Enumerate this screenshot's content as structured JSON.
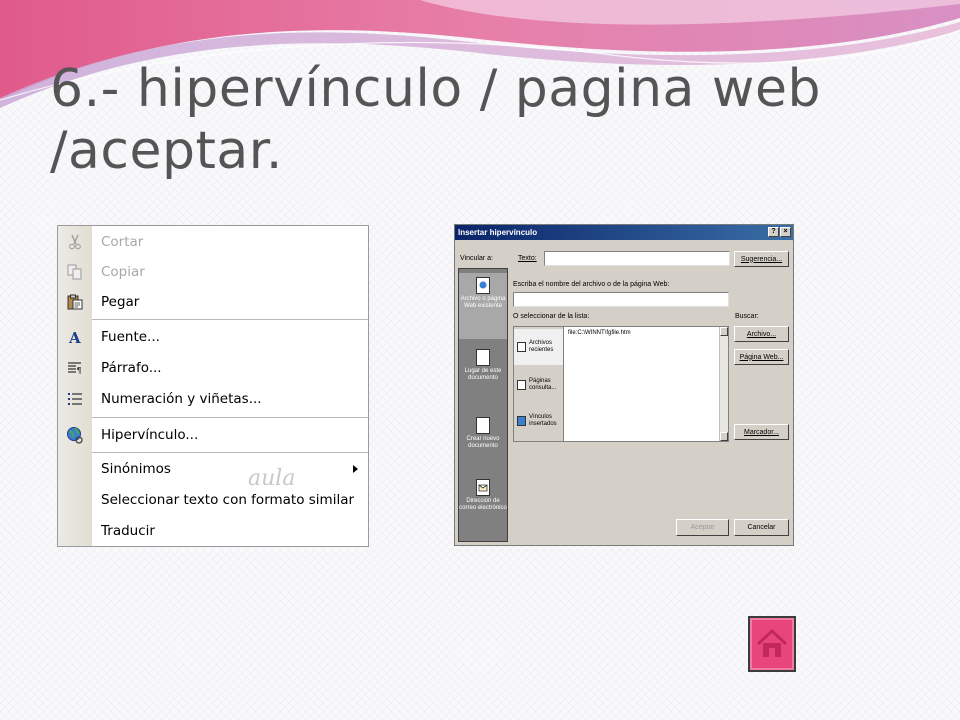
{
  "slide": {
    "title_line1": "6.- hipervínculo / pagina web",
    "title_line2": "/aceptar."
  },
  "colors": {
    "wave_pink": "#e65a8c",
    "wave_lavender": "#d9a8d6",
    "title_text": "#555555",
    "home_button": "#e8457c",
    "dialog_titlebar": "#0a246a",
    "dialog_face": "#d4d0c8"
  },
  "context_menu": {
    "items": [
      {
        "label": "Cortar",
        "icon": "scissors-icon",
        "disabled": true
      },
      {
        "label": "Copiar",
        "icon": "copy-icon",
        "disabled": true
      },
      {
        "label": "Pegar",
        "icon": "paste-icon",
        "disabled": false
      },
      {
        "label": "Fuente...",
        "icon": "font-icon",
        "disabled": false
      },
      {
        "label": "Párrafo...",
        "icon": "paragraph-icon",
        "disabled": false
      },
      {
        "label": "Numeración y viñetas...",
        "icon": "bullet-list-icon",
        "disabled": false
      },
      {
        "label": "Hipervínculo...",
        "icon": "hyperlink-globe-icon",
        "disabled": false
      },
      {
        "label": "Sinónimos",
        "icon": "",
        "disabled": false,
        "submenu": true
      },
      {
        "label": "Seleccionar texto con formato similar",
        "icon": "",
        "disabled": false
      },
      {
        "label": "Traducir",
        "icon": "",
        "disabled": false
      }
    ],
    "watermark": "aula"
  },
  "dialog": {
    "title": "Insertar hipervínculo",
    "help_btn": "?",
    "close_btn": "×",
    "link_to_label": "Vincular a:",
    "text_label": "Texto:",
    "text_value": "",
    "hint_btn": "Sugerencia...",
    "filename_prompt": "Escriba el nombre del archivo o de la página Web:",
    "filename_value": "",
    "select_list_label": "O seleccionar de la lista:",
    "browse_label": "Buscar:",
    "browse_file_btn": "Archivo...",
    "browse_web_btn": "Página Web...",
    "bookmark_btn": "Marcador...",
    "list_entry": "file:C:\\WINNT\\fgfile.htm",
    "accept_btn": "Aceptar",
    "cancel_btn": "Cancelar",
    "sidebar": [
      {
        "label": "Archivo o página Web existente",
        "icon": "web-page-icon",
        "selected": true
      },
      {
        "label": "Lugar de este documento",
        "icon": "document-place-icon",
        "selected": false
      },
      {
        "label": "Crear nuevo documento",
        "icon": "new-document-icon",
        "selected": false
      },
      {
        "label": "Dirección de correo electrónico",
        "icon": "email-icon",
        "selected": false
      }
    ],
    "tabs": [
      {
        "label": "Archivos recientes",
        "icon": "recent-files-icon"
      },
      {
        "label": "Páginas consulta...",
        "icon": "browsed-pages-icon"
      },
      {
        "label": "Vínculos insertados",
        "icon": "inserted-links-icon"
      }
    ]
  }
}
